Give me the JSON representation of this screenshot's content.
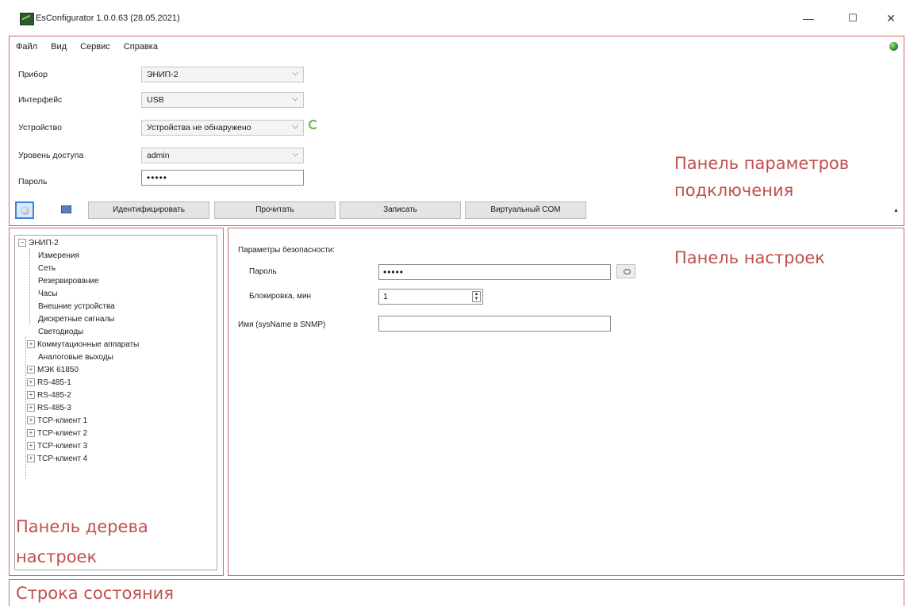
{
  "window": {
    "title": "EsConfigurator 1.0.0.63 (28.05.2021)",
    "minimize": "—",
    "maximize": "☐",
    "close": "✕"
  },
  "menu": [
    "Файл",
    "Вид",
    "Сервис",
    "Справка"
  ],
  "connection": {
    "device_label": "Прибор",
    "device_value": "ЭНИП-2",
    "interface_label": "Интерфейс",
    "interface_value": "USB",
    "unit_label": "Устройство",
    "unit_value": "Устройства не обнаружено",
    "access_label": "Уровень доступа",
    "access_value": "admin",
    "password_label": "Пароль",
    "password_value": "•••••"
  },
  "toolbar": {
    "identify": "Идентифицировать",
    "read": "Прочитать",
    "write": "Записать",
    "virtual_com": "Виртуальный COM"
  },
  "tree": {
    "root": "ЭНИП-2",
    "items": [
      "Измерения",
      "Сеть",
      "Резервирование",
      "Часы",
      "Внешние устройства",
      "Дискретные сигналы",
      "Светодиоды",
      "Коммутационные аппараты",
      "Аналоговые выходы",
      "МЭК 61850",
      "RS-485-1",
      "RS-485-2",
      "RS-485-3",
      "TCP-клиент 1",
      "TCP-клиент 2",
      "TCP-клиент 3",
      "TCP-клиент 4"
    ]
  },
  "settings": {
    "section_title": "Параметры безопасности:",
    "password_label": "Пароль",
    "password_value": "•••••",
    "lock_label": "Блокировка, мин",
    "lock_value": "1",
    "name_label": "Имя (sysName в SNMP)",
    "name_value": ""
  },
  "annotations": {
    "connection_panel_line1": "Панель параметров",
    "connection_panel_line2": "подключения",
    "settings_panel": "Панель настроек",
    "tree_panel_line1": "Панель дерева",
    "tree_panel_line2": "настроек",
    "status_bar": "Строка состояния"
  },
  "colors": {
    "annotation_red": "#c0504d",
    "frame_red": "#c96a6a",
    "active_button_blue": "#3d86d6"
  }
}
